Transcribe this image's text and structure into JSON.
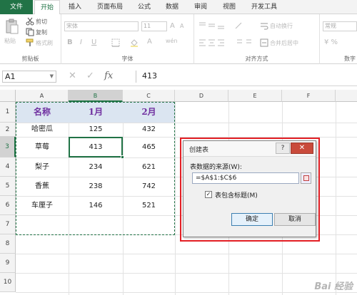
{
  "ribbon": {
    "file_tab": "文件",
    "tabs": [
      {
        "label": "开始",
        "active": true
      },
      {
        "label": "插入",
        "active": false
      },
      {
        "label": "页面布局",
        "active": false
      },
      {
        "label": "公式",
        "active": false
      },
      {
        "label": "数据",
        "active": false
      },
      {
        "label": "审阅",
        "active": false
      },
      {
        "label": "视图",
        "active": false
      },
      {
        "label": "开发工具",
        "active": false
      }
    ],
    "clipboard": {
      "paste": "粘贴",
      "cut": "剪切",
      "copy": "复制",
      "format_painter": "格式刷",
      "label": "剪贴板"
    },
    "font": {
      "name": "宋体",
      "size": "11",
      "bold": "B",
      "italic": "I",
      "underline": "U",
      "grow": "A",
      "shrink": "A",
      "color_letter": "A",
      "wen": "wén",
      "label": "字体"
    },
    "alignment": {
      "wrap": "自动换行",
      "merge": "合并后居中",
      "label": "对齐方式"
    },
    "number": {
      "format": "常规",
      "label": "数字"
    }
  },
  "formula_bar": {
    "name_box": "A1",
    "formula": "413",
    "cancel": "✕",
    "enter": "✓",
    "fx": "fx"
  },
  "grid": {
    "columns": [
      "A",
      "B",
      "C",
      "D",
      "E",
      "F"
    ],
    "rows": [
      "1",
      "2",
      "3",
      "4",
      "5",
      "6",
      "7",
      "8",
      "9",
      "10"
    ],
    "header": [
      "名称",
      "1月",
      "2月"
    ],
    "data": [
      [
        "哈密瓜",
        "125",
        "432"
      ],
      [
        "草莓",
        "413",
        "465"
      ],
      [
        "梨子",
        "234",
        "621"
      ],
      [
        "香蕉",
        "238",
        "742"
      ],
      [
        "车厘子",
        "146",
        "521"
      ]
    ]
  },
  "dialog": {
    "title": "创建表",
    "help": "?",
    "close": "✕",
    "source_label": "表数据的来源(W):",
    "source_value": "=$A$1:$C$6",
    "has_headers_label": "表包含标题(M)",
    "has_headers_checked": "✓",
    "ok": "确定",
    "cancel": "取消"
  },
  "watermark": "Bai 经验"
}
